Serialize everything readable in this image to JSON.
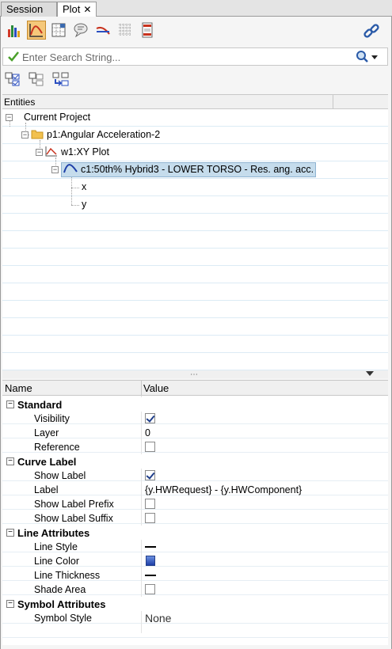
{
  "tabs": {
    "session": "Session",
    "plot": "Plot",
    "close": "✕"
  },
  "toolbar": {
    "icons": [
      "bar-chart-icon",
      "xy-curve-icon",
      "data-table-icon",
      "note-icon",
      "curve-style-icon",
      "grid-icon",
      "page-icon"
    ],
    "link_icon": "link-icon"
  },
  "search": {
    "placeholder": "Enter Search String..."
  },
  "entities": {
    "header": "Entities",
    "tree": {
      "project": "Current Project",
      "page": "p1:Angular Acceleration-2",
      "window": "w1:XY Plot",
      "curve": "c1:50th% Hybrid3   - LOWER TORSO - Res. ang. acc.",
      "x": "x",
      "y": "y"
    }
  },
  "props": {
    "col_name": "Name",
    "col_value": "Value",
    "standard": {
      "title": "Standard",
      "visibility": "Visibility",
      "layer": "Layer",
      "layer_value": "0",
      "reference": "Reference"
    },
    "curve_label": {
      "title": "Curve Label",
      "show_label": "Show Label",
      "label": "Label",
      "label_value": "{y.HWRequest} - {y.HWComponent}",
      "show_prefix": "Show Label Prefix",
      "show_suffix": "Show Label Suffix"
    },
    "line_attr": {
      "title": "Line Attributes",
      "style": "Line Style",
      "color": "Line Color",
      "thickness": "Line Thickness",
      "shade": "Shade Area"
    },
    "symbol_attr": {
      "title": "Symbol Attributes",
      "style": "Symbol Style",
      "style_value": "None"
    }
  },
  "colors": {
    "selection": "#c5dcec",
    "line_color": "#1d3fa8",
    "accent": "#f5c87a"
  }
}
